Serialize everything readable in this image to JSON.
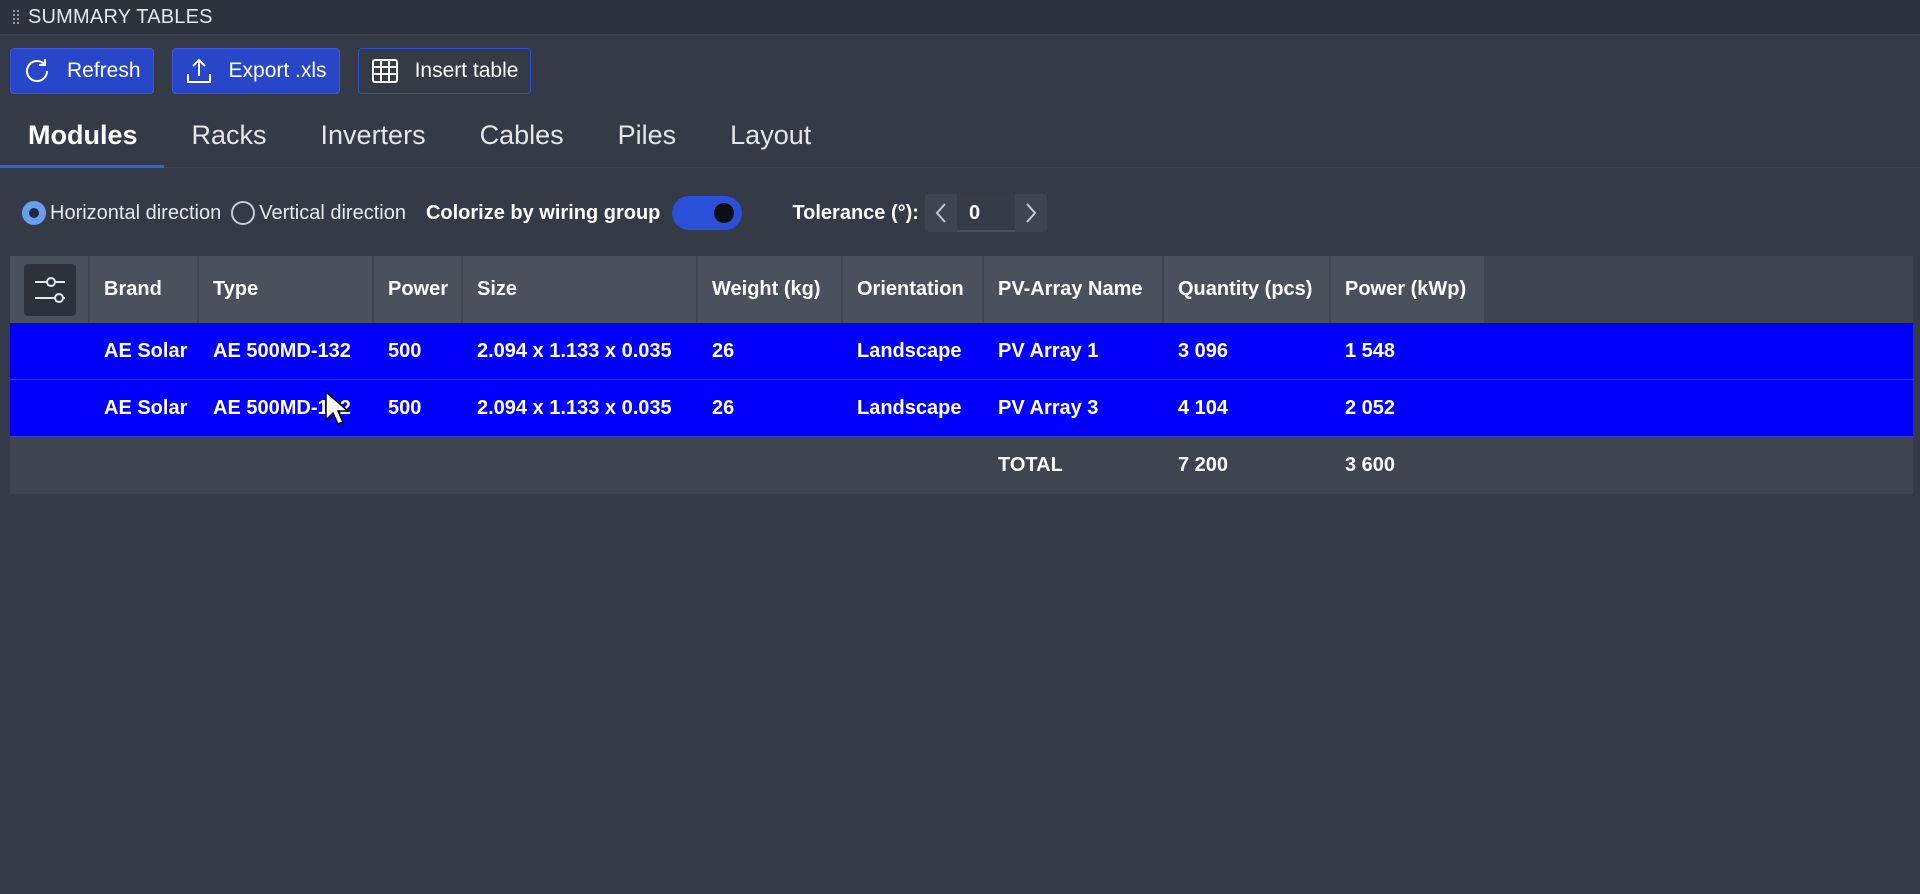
{
  "panel": {
    "title": "SUMMARY TABLES"
  },
  "toolbar": {
    "refresh_label": "Refresh",
    "export_label": "Export .xls",
    "insert_label": "Insert table"
  },
  "tabs": [
    {
      "label": "Modules",
      "active": true
    },
    {
      "label": "Racks"
    },
    {
      "label": "Inverters"
    },
    {
      "label": "Cables"
    },
    {
      "label": "Piles"
    },
    {
      "label": "Layout"
    }
  ],
  "options": {
    "horizontal_label": "Horizontal direction",
    "vertical_label": "Vertical direction",
    "selected": "horizontal",
    "colorize_label": "Colorize by wiring group",
    "colorize_on": true,
    "tolerance_label": "Tolerance (°):",
    "tolerance_value": "0"
  },
  "table": {
    "columns": [
      "Brand",
      "Type",
      "Power",
      "Size",
      "Weight (kg)",
      "Orientation",
      "PV-Array Name",
      "Quantity (pcs)",
      "Power (kWp)"
    ],
    "rows": [
      [
        "AE Solar",
        "AE 500MD-132",
        "500",
        "2.094 x 1.133 x 0.035",
        "26",
        "Landscape",
        "PV Array 1",
        "3 096",
        "1 548"
      ],
      [
        "AE Solar",
        "AE 500MD-132",
        "500",
        "2.094 x 1.133 x 0.035",
        "26",
        "Landscape",
        "PV Array 3",
        "4 104",
        "2 052"
      ]
    ],
    "total": {
      "label": "TOTAL",
      "quantity": "7 200",
      "power": "3 600"
    }
  },
  "colors": {
    "background": "#343a46",
    "accent": "#2746c8",
    "row_highlight": "#0000fb"
  }
}
